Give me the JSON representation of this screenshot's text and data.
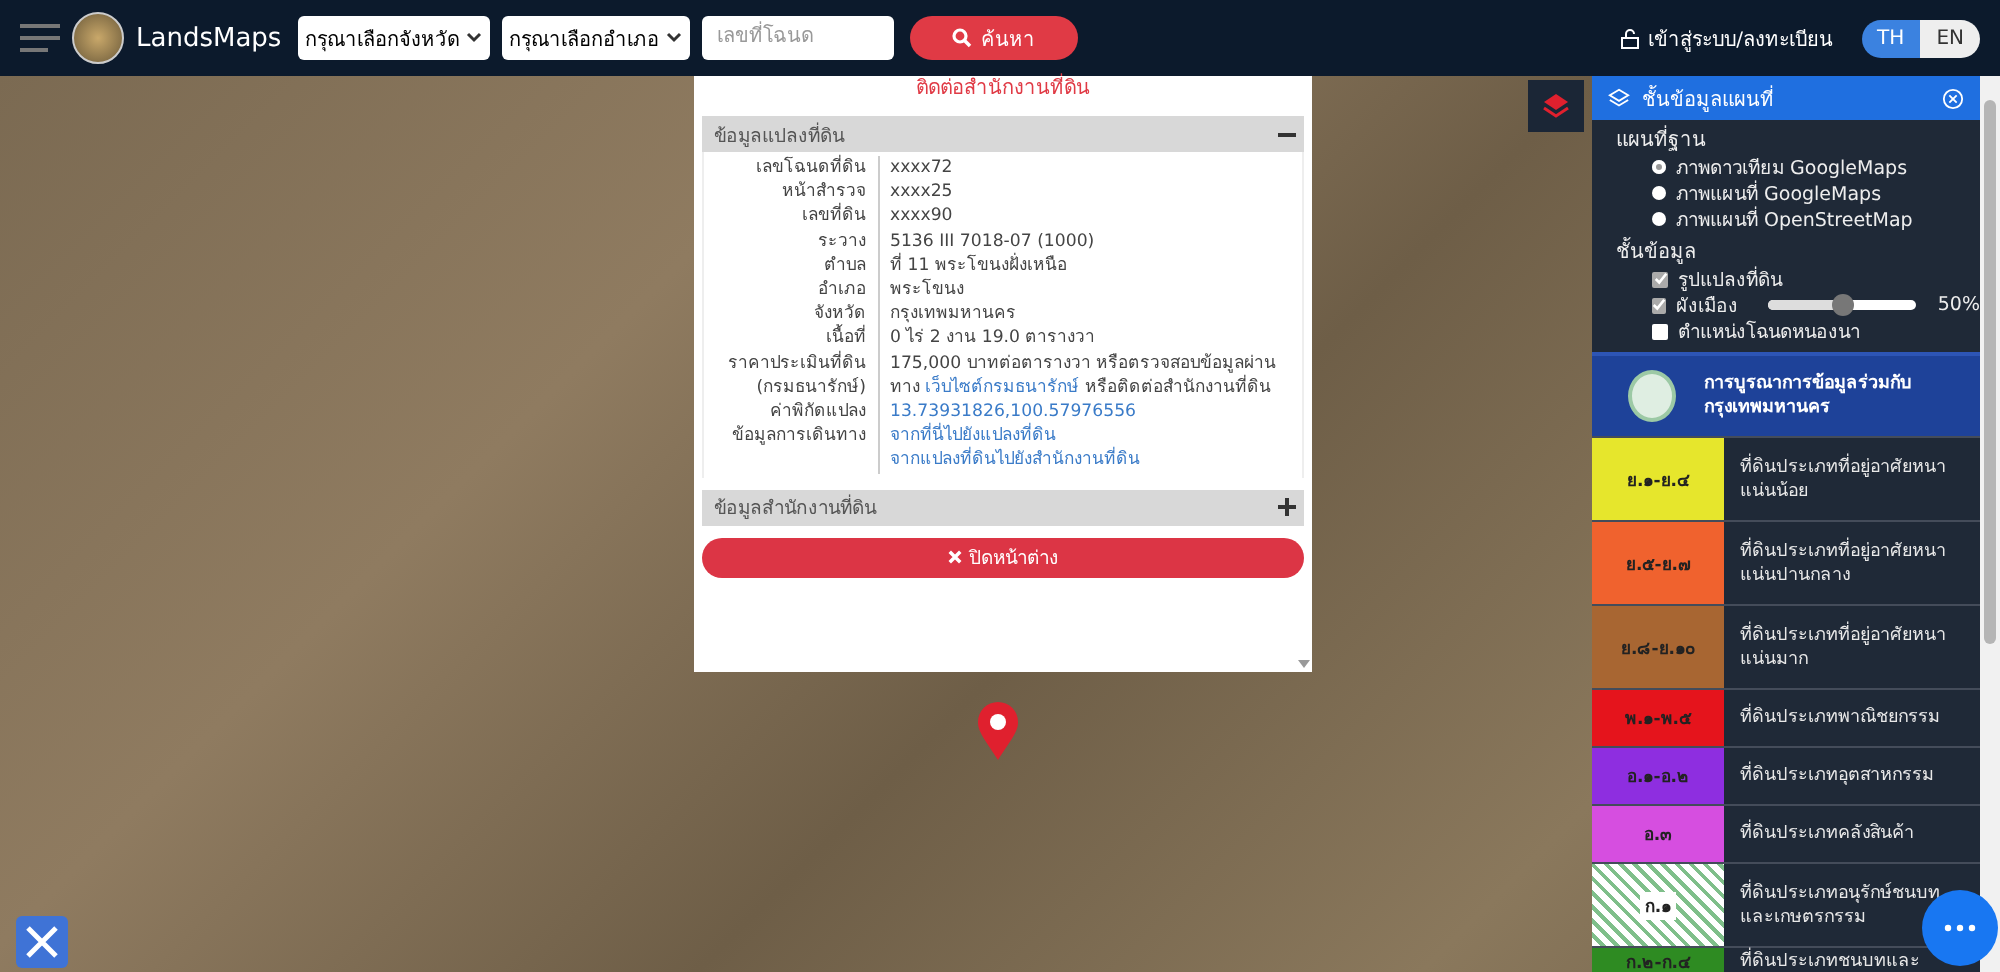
{
  "header": {
    "brand": "LandsMaps",
    "province_select": "กรุณาเลือกจังหวัด",
    "district_select": "กรุณาเลือกอำเภอ",
    "deed_field": {
      "placeholder": "เลขที่โฉนด"
    },
    "search_button": "ค้นหา",
    "login": "เข้าสู่ระบบ/ลงทะเบียน",
    "languages": [
      {
        "label": "TH",
        "selected": true
      },
      {
        "label": "EN",
        "selected": false
      }
    ]
  },
  "popup": {
    "top_text": "ติดต่อสำนักงานที่ดิน",
    "sections": [
      {
        "title": "ข้อมูลแปลงที่ดิน",
        "expanded": true,
        "rows": [
          {
            "label": "เลขโฉนดที่ดิน",
            "value": "xxxx72"
          },
          {
            "label": "หน้าสำรวจ",
            "value": "xxxx25"
          },
          {
            "label": "เลขที่ดิน",
            "value": "xxxx90"
          },
          {
            "label": "ระวาง",
            "value": "5136 III 7018-07 (1000)"
          },
          {
            "label": "ตำบล",
            "value": "ที่ 11 พระโขนงฝั่งเหนือ"
          },
          {
            "label": "อำเภอ",
            "value": "พระโขนง"
          },
          {
            "label": "จังหวัด",
            "value": "กรุงเทพมหานคร"
          },
          {
            "label": "เนื้อที่",
            "value": "0 ไร่ 2 งาน 19.0 ตารางวา"
          },
          {
            "label": "ราคาประเมินที่ดิน",
            "value": "175,000 บาทต่อตารางวา หรือตรวจสอบข้อมูลผ่าน"
          },
          {
            "label": "(กรมธนารักษ์)",
            "value": "ทาง",
            "link": "เว็บไซต์กรมธนารักษ์",
            "after": "หรือติดต่อสำนักงานที่ดิน"
          },
          {
            "label": "ค่าพิกัดแปลง",
            "link": "13.73931826,100.57976556"
          },
          {
            "label": "ข้อมูลการเดินทาง",
            "link": "จากที่นี่ไปยังแปลงที่ดิน"
          },
          {
            "link": "จากแปลงที่ดินไปยังสำนักงานที่ดิน"
          }
        ]
      },
      {
        "title": "ข้อมูลสำนักงานที่ดิน",
        "expanded": false
      }
    ],
    "close_button": "ปิดหน้าต่าง"
  },
  "layers_panel": {
    "title": "ชั้นข้อมูลแผนที่",
    "base_heading": "แผนที่ฐาน",
    "base_maps": [
      {
        "label": "ภาพดาวเทียม GoogleMaps",
        "selected": true
      },
      {
        "label": "ภาพแผนที่ GoogleMaps",
        "selected": false
      },
      {
        "label": "ภาพแผนที่ OpenStreetMap",
        "selected": false
      }
    ],
    "layers_heading": "ชั้นข้อมูล",
    "layers": [
      {
        "label": "รูปแปลงที่ดิน",
        "checked": true
      },
      {
        "label": "ผังเมือง",
        "checked": true,
        "level": 0.5,
        "reading": "50%"
      },
      {
        "label": "ตำแหน่งโฉนดหนองนา",
        "checked": false
      }
    ],
    "banner": "การบูรณาการข้อมูลร่วมกับ กรุงเทพมหานคร",
    "legend": [
      {
        "code": "ย.๑-ย.๔",
        "color": "#e6e62c",
        "kind": "solid",
        "text": "ที่ดินประเภทที่อยู่อาศัยหนาแน่นน้อย"
      },
      {
        "code": "ย.๕-ย.๗",
        "color": "#f0622e",
        "kind": "solid",
        "text": "ที่ดินประเภทที่อยู่อาศัยหนาแน่นปานกลาง"
      },
      {
        "code": "ย.๘-ย.๑๐",
        "color": "#a86632",
        "kind": "solid",
        "text": "ที่ดินประเภทที่อยู่อาศัยหนาแน่นมาก"
      },
      {
        "code": "พ.๑-พ.๕",
        "color": "#e5141c",
        "kind": "solid",
        "text": "ที่ดินประเภทพาณิชยกรรม"
      },
      {
        "code": "อ.๑-อ.๒",
        "color": "#8e2ee0",
        "kind": "solid",
        "text": "ที่ดินประเภทอุตสาหกรรม"
      },
      {
        "code": "อ.๓",
        "color": "#d64ee0",
        "kind": "solid",
        "text": "ที่ดินประเภทคลังสินค้า"
      },
      {
        "code": "ก.๑",
        "color": "#7fbf8a",
        "kind": "hatched",
        "text": "ที่ดินประเภทอนุรักษ์ชนบทและเกษตรกรรม"
      },
      {
        "code": "ก.๒-ก.๔",
        "color": "#2e8b22",
        "kind": "solid",
        "text": "ที่ดินประเภทชนบทและ"
      }
    ]
  }
}
